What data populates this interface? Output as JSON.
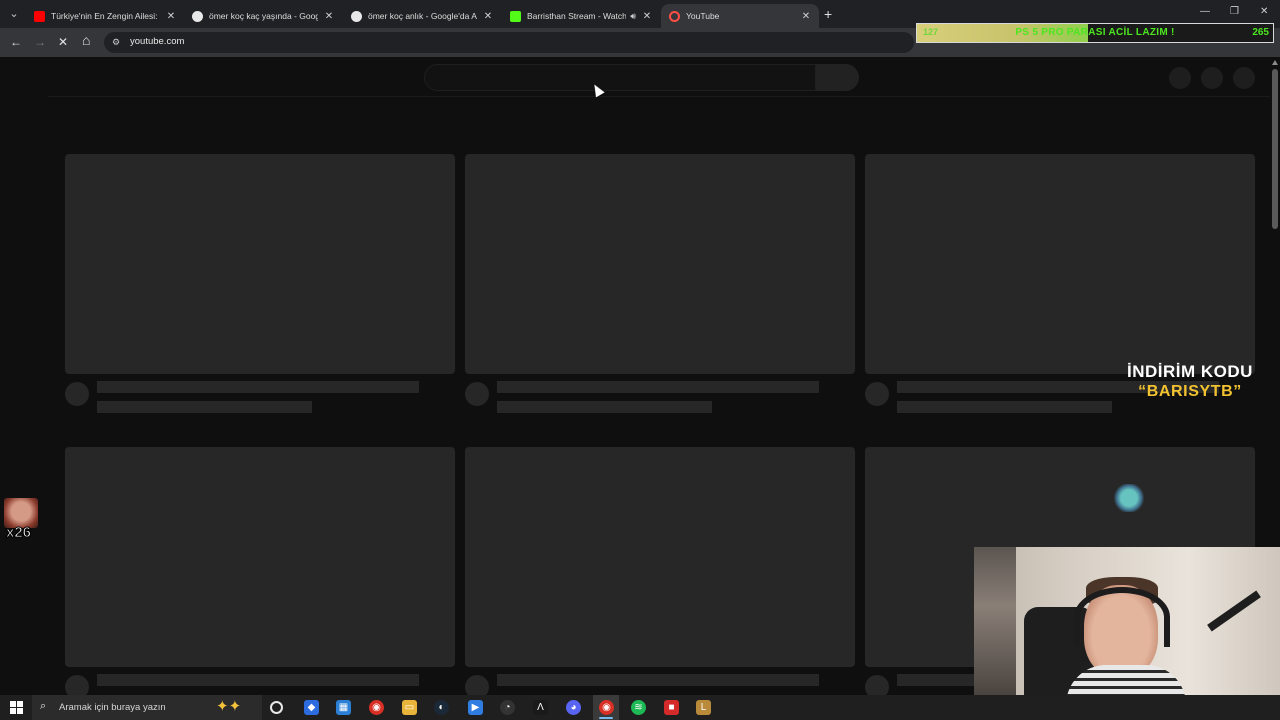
{
  "browser": {
    "tabs": [
      {
        "title": "Türkiye'nin En Zengin Ailesi: Ko",
        "favicon": "youtube-icon",
        "color": "#ff0000",
        "active": false
      },
      {
        "title": "ömer koç kaç yaşında - Google'",
        "favicon": "google-icon",
        "color": "#e8e8e8",
        "active": false
      },
      {
        "title": "ömer koç anlık - Google'da Ara",
        "favicon": "google-icon",
        "color": "#e8e8e8",
        "active": false
      },
      {
        "title": "Barristhan Stream - Watch L",
        "favicon": "kick-icon",
        "color": "#53fc18",
        "active": false,
        "audio": true
      },
      {
        "title": "YouTube",
        "favicon": "loading-icon",
        "color": "#ff4e45",
        "active": true
      }
    ],
    "address": {
      "url": "youtube.com"
    },
    "toolbar": {
      "back": "←",
      "forward": "→",
      "reload": "✕",
      "home": "⌂"
    }
  },
  "overlay": {
    "banner": {
      "left_value": "127",
      "message": "PS 5 PRO PARASI ACİL LAZIM !",
      "right_value": "265",
      "progress": 0.48
    },
    "promo": {
      "line1": "İNDİRİM KODU",
      "line2": "“BARISYTB”"
    },
    "emote": {
      "count": "x26"
    }
  },
  "taskbar": {
    "search_placeholder": "Aramak için buraya yazın",
    "apps": [
      {
        "name": "task-view-icon",
        "glyph": "◯",
        "color": "#1f1f1f"
      },
      {
        "name": "vpn-icon",
        "glyph": "◆",
        "color": "#2d6cdf"
      },
      {
        "name": "store-icon",
        "glyph": "▦",
        "color": "#2b80d6"
      },
      {
        "name": "chrome-icon",
        "glyph": "◉",
        "color": "#d93025"
      },
      {
        "name": "file-explorer-icon",
        "glyph": "▭",
        "color": "#e8b43a"
      },
      {
        "name": "steam-icon",
        "glyph": "◐",
        "color": "#1b2838"
      },
      {
        "name": "app-blue-icon",
        "glyph": "▶",
        "color": "#2f7de1"
      },
      {
        "name": "speedtest-icon",
        "glyph": "◔",
        "color": "#333333"
      },
      {
        "name": "nvidia-icon",
        "glyph": "Λ",
        "color": "#1a1a1a"
      },
      {
        "name": "discord-icon",
        "glyph": "◕",
        "color": "#5865f2"
      },
      {
        "name": "chrome-active-icon",
        "glyph": "◉",
        "color": "#d93025"
      },
      {
        "name": "spotify-icon",
        "glyph": "≋",
        "color": "#1db954"
      },
      {
        "name": "app-red-icon",
        "glyph": "■",
        "color": "#d42a2a"
      },
      {
        "name": "league-icon",
        "glyph": "L",
        "color": "#b88a3a"
      }
    ]
  }
}
